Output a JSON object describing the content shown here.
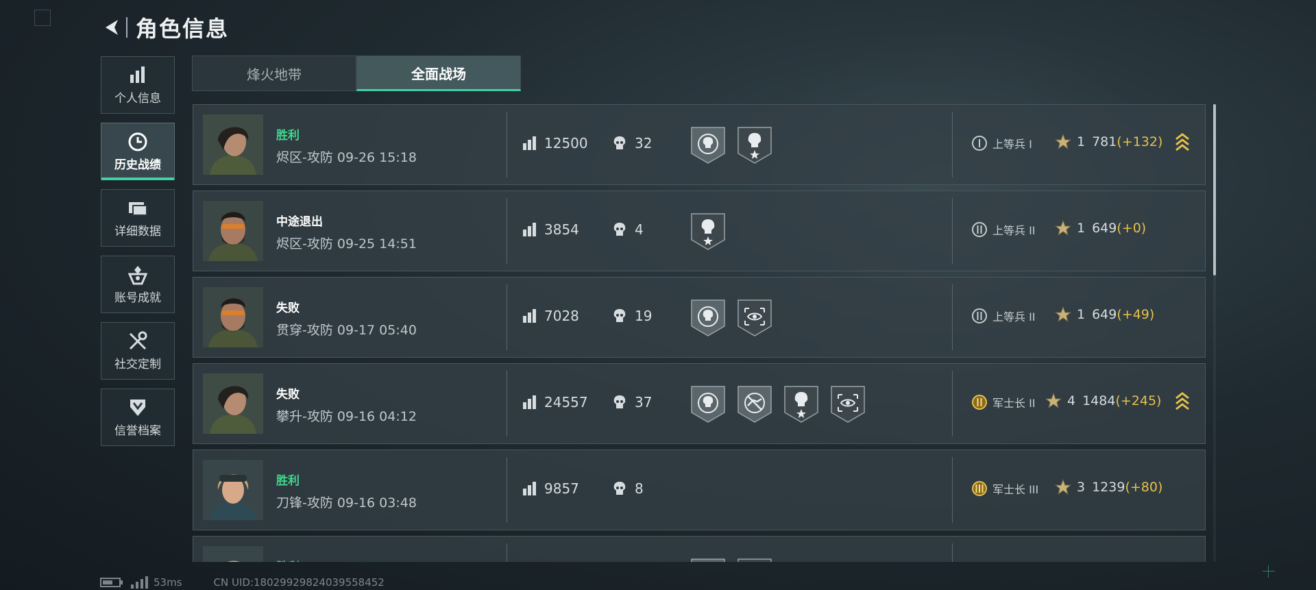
{
  "page": {
    "title": "角色信息"
  },
  "sidebar": {
    "items": [
      {
        "label": "个人信息",
        "icon": "bar-chart-icon",
        "active": false
      },
      {
        "label": "历史战绩",
        "icon": "clock-icon",
        "active": true
      },
      {
        "label": "详细数据",
        "icon": "cards-icon",
        "active": false
      },
      {
        "label": "账号成就",
        "icon": "achievement-icon",
        "active": false
      },
      {
        "label": "社交定制",
        "icon": "tools-icon",
        "active": false
      },
      {
        "label": "信誉档案",
        "icon": "shield-icon",
        "active": false
      }
    ]
  },
  "tabs": [
    {
      "label": "烽火地带",
      "active": false
    },
    {
      "label": "全面战场",
      "active": true
    }
  ],
  "matches": [
    {
      "result": "胜利",
      "win": true,
      "mode": "烬区-攻防",
      "time": "09-26 15:18",
      "score": "12500",
      "kills": "32",
      "badges": [
        "skull-target-badge-icon",
        "skull-star-badge-icon"
      ],
      "rank": "上等兵 I",
      "rank_level": "I",
      "stars": "1",
      "points": "781",
      "delta": "(+132)",
      "promoted": true
    },
    {
      "result": "中途退出",
      "win": false,
      "mode": "烬区-攻防",
      "time": "09-25 14:51",
      "score": "3854",
      "kills": "4",
      "badges": [
        "skull-star-badge-icon"
      ],
      "rank": "上等兵 II",
      "rank_level": "II",
      "stars": "1",
      "points": "649",
      "delta": "(+0)",
      "promoted": false
    },
    {
      "result": "失败",
      "win": false,
      "mode": "贯穿-攻防",
      "time": "09-17 05:40",
      "score": "7028",
      "kills": "19",
      "badges": [
        "skull-target-badge-icon",
        "eye-target-badge-icon"
      ],
      "rank": "上等兵 II",
      "rank_level": "II",
      "stars": "1",
      "points": "649",
      "delta": "(+49)",
      "promoted": false
    },
    {
      "result": "失败",
      "win": false,
      "mode": "攀升-攻防",
      "time": "09-16 04:12",
      "score": "24557",
      "kills": "37",
      "badges": [
        "skull-target-badge-icon",
        "no-vehicle-badge-icon",
        "skull-star-badge-icon",
        "eye-target-badge-icon"
      ],
      "rank": "军士长 II",
      "rank_level": "II",
      "stars": "4",
      "points": "1484",
      "delta": "(+245)",
      "promoted": true
    },
    {
      "result": "胜利",
      "win": true,
      "mode": "刀锋-攻防",
      "time": "09-16 03:48",
      "score": "9857",
      "kills": "8",
      "badges": [],
      "rank": "军士长 III",
      "rank_level": "III",
      "stars": "3",
      "points": "1239",
      "delta": "(+80)",
      "promoted": false
    },
    {
      "result": "胜利",
      "win": true,
      "mode": "",
      "time": "",
      "score": "",
      "kills": "",
      "badges": [
        "skull-target-badge-icon",
        "skull-star-badge-icon"
      ],
      "rank": "",
      "rank_level": "",
      "stars": "",
      "points": "",
      "delta": "",
      "promoted": false
    }
  ],
  "status": {
    "latency": "53ms",
    "uid": "CN UID:18029929824039558452"
  },
  "colors": {
    "accent": "#3fd0a5",
    "win": "#40d78c",
    "gold": "#e6c24a"
  }
}
